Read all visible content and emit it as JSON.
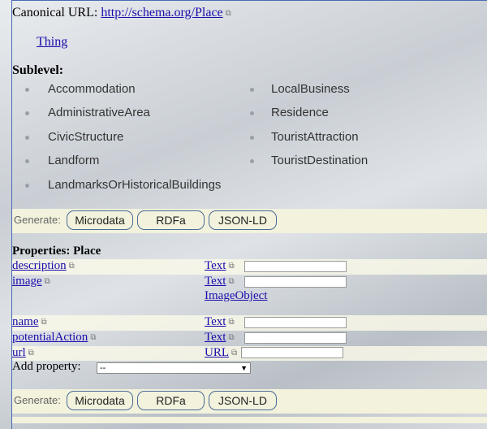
{
  "canonical": {
    "label": "Canonical URL:",
    "url": "http://schema.org/Place"
  },
  "parent_link": "Thing",
  "sublevel": {
    "title": "Sublevel:",
    "left_items": [
      "Accommodation",
      "AdministrativeArea",
      "CivicStructure",
      "Landform",
      "LandmarksOrHistoricalBuildings"
    ],
    "right_items": [
      "LocalBusiness",
      "Residence",
      "TouristAttraction",
      "TouristDestination"
    ]
  },
  "generate": {
    "label": "Generate:",
    "buttons": [
      "Microdata",
      "RDFa",
      "JSON-LD"
    ]
  },
  "properties": {
    "title": "Properties: Place",
    "rows": [
      {
        "name": "description",
        "types": [
          "Text"
        ]
      },
      {
        "name": "image",
        "types": [
          "Text",
          "ImageObject"
        ]
      },
      {
        "name": "name",
        "types": [
          "Text"
        ]
      },
      {
        "name": "potentialAction",
        "types": [
          "Text"
        ]
      },
      {
        "name": "url",
        "types": [
          "URL"
        ]
      }
    ]
  },
  "add_property": {
    "label": "Add property:",
    "selected": "--"
  },
  "icons": {
    "external": "external-link-icon",
    "dropdown": "chevron-down-icon"
  },
  "colors": {
    "link": "#1a0dab",
    "panel": "#f2f2dd",
    "border": "#4a6bb4"
  }
}
